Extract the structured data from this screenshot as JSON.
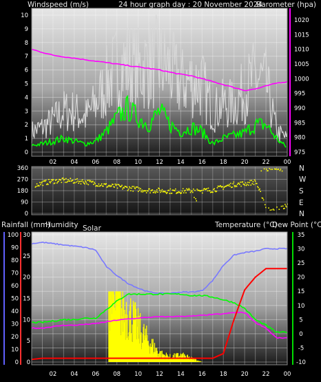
{
  "header": {
    "left_label": "Windspeed (m/s)",
    "title": "24 hour graph day : 20 November 2024",
    "right_label": "Barometer (hpa)"
  },
  "direction_labels": [
    "N",
    "W",
    "S",
    "E",
    "N"
  ],
  "bottom_header": {
    "rainfall_label": "Rainfall (mm)",
    "humidity_label": "Humidity",
    "solar_label": "Solar",
    "temperature_label": "Temperature (°C)",
    "dewpoint_label": "Dew Point (°C)"
  },
  "x_ticks": [
    "02",
    "04",
    "06",
    "08",
    "10",
    "12",
    "14",
    "16",
    "18",
    "20",
    "22",
    "00"
  ],
  "colors": {
    "wind_gust": "#d8d8d8",
    "wind_avg": "#00ff00",
    "barometer": "#ff00ff",
    "direction": "#ffff00",
    "humidity": "#7878ff",
    "temperature": "#00ff00",
    "dewpoint": "#ff00ff",
    "rain": "#ff0000",
    "solar": "#ffff00",
    "rain_axis": "#ff3030",
    "humidity_axis": "#6060ff",
    "temp_axis": "#00dd00"
  },
  "chart_data": [
    {
      "type": "line",
      "title": "24 hour graph day : 20 November 2024",
      "ylabel": "Windspeed (m/s)",
      "y2label": "Barometer (hpa)",
      "ylim": [
        0,
        10.5
      ],
      "y2lim": [
        975,
        1024
      ],
      "y_ticks": [
        "0",
        "1",
        "2",
        "3",
        "4",
        "5",
        "6",
        "7",
        "8",
        "9",
        "10"
      ],
      "y2_ticks": [
        "975",
        "980",
        "985",
        "990",
        "995",
        "1000",
        "1005",
        "1010",
        "1015",
        "1020"
      ],
      "x_hours": [
        0,
        1,
        2,
        3,
        4,
        5,
        6,
        7,
        8,
        9,
        10,
        11,
        12,
        13,
        14,
        15,
        16,
        17,
        18,
        19,
        20,
        21,
        22,
        23,
        24
      ],
      "series": [
        {
          "name": "gust",
          "values": [
            1.5,
            1.8,
            2.3,
            3.0,
            3.0,
            2.5,
            3.5,
            5.0,
            6.2,
            6.4,
            6.0,
            6.5,
            6.5,
            6.0,
            5.0,
            5.2,
            5.0,
            3.0,
            3.5,
            3.5,
            4.5,
            5.5,
            5.0,
            1.5,
            1.0
          ]
        },
        {
          "name": "average",
          "values": [
            0.5,
            0.6,
            0.8,
            1.0,
            0.8,
            0.6,
            0.8,
            1.5,
            2.5,
            3.2,
            2.5,
            2.0,
            3.0,
            2.0,
            1.5,
            1.8,
            1.5,
            0.6,
            1.0,
            1.2,
            1.4,
            2.0,
            2.0,
            1.0,
            0.3
          ]
        },
        {
          "name": "barometer",
          "values": [
            1010,
            1009,
            1008,
            1007.5,
            1007,
            1006.5,
            1006,
            1005.5,
            1005,
            1004.5,
            1004,
            1003.5,
            1003,
            1002.2,
            1001.5,
            1001,
            1000,
            999,
            998,
            997,
            996,
            996.5,
            997.5,
            998.5,
            999
          ]
        }
      ]
    },
    {
      "type": "scatter",
      "ylabel": "direction",
      "ylim": [
        0,
        360
      ],
      "y_ticks": [
        "0",
        "90",
        "180",
        "270",
        "360"
      ],
      "x_hours": [
        0,
        1,
        2,
        3,
        4,
        5,
        6,
        7,
        8,
        9,
        10,
        11,
        12,
        13,
        14,
        15,
        16,
        17,
        18,
        19,
        20,
        21,
        22,
        23,
        24
      ],
      "values": [
        220,
        245,
        260,
        265,
        260,
        255,
        240,
        225,
        215,
        205,
        195,
        185,
        185,
        180,
        180,
        185,
        185,
        190,
        215,
        235,
        240,
        255,
        50,
        45,
        60
      ]
    },
    {
      "type": "line",
      "ylabel": "Rainfall (mm)",
      "y_left_outer_label": "Humidity",
      "y2label": "Temperature (°C)",
      "ylim_rain": [
        0,
        30
      ],
      "ylim_humidity": [
        0,
        100
      ],
      "ylim_temp": [
        -10,
        35
      ],
      "rain_ticks": [
        "0",
        "5",
        "10",
        "15",
        "20",
        "25",
        "30"
      ],
      "humidity_ticks": [
        "0",
        "10",
        "20",
        "30",
        "40",
        "50",
        "60",
        "70",
        "80",
        "90",
        "100"
      ],
      "temp_ticks": [
        "-10",
        "-5",
        "0",
        "5",
        "10",
        "15",
        "20",
        "25",
        "30",
        "35"
      ],
      "x_hours": [
        0,
        1,
        2,
        3,
        4,
        5,
        6,
        7,
        8,
        9,
        10,
        11,
        12,
        13,
        14,
        15,
        16,
        17,
        18,
        19,
        20,
        21,
        22,
        23,
        24
      ],
      "series": [
        {
          "name": "humidity",
          "values": [
            93,
            94,
            93,
            92,
            91,
            90,
            88,
            75,
            68,
            62,
            58,
            55,
            54,
            54,
            55,
            55,
            56,
            64,
            76,
            84,
            86,
            87,
            89,
            89,
            89
          ]
        },
        {
          "name": "temperature",
          "values": [
            4,
            4,
            4.5,
            5,
            5,
            5.5,
            5.5,
            8.5,
            11.5,
            14,
            14,
            14,
            14,
            14,
            14,
            13.5,
            13.5,
            13,
            12,
            11,
            9,
            5,
            3,
            0.5,
            0.5
          ]
        },
        {
          "name": "dewpoint",
          "values": [
            2,
            2,
            2.5,
            3,
            3,
            3.3,
            3.6,
            4.2,
            4.8,
            5.2,
            5.5,
            5.8,
            6.0,
            6.0,
            6.2,
            6.2,
            6.5,
            6.8,
            7.0,
            7.5,
            7.5,
            4,
            2,
            -1.5,
            -1.5
          ]
        },
        {
          "name": "rainfall",
          "values": [
            0.6,
            0.9,
            0.9,
            0.9,
            0.9,
            0.9,
            0.9,
            0.9,
            0.9,
            0.9,
            0.9,
            0.9,
            0.9,
            0.9,
            0.9,
            0.9,
            0.9,
            0.9,
            2,
            10,
            17,
            20,
            22,
            22,
            22
          ]
        },
        {
          "name": "solar",
          "values": [
            0,
            0,
            0,
            0,
            0,
            0,
            0,
            0,
            32,
            30,
            20,
            12,
            5,
            3,
            4,
            2,
            0,
            0,
            0,
            0,
            0,
            0,
            0,
            0,
            0
          ]
        }
      ]
    }
  ]
}
